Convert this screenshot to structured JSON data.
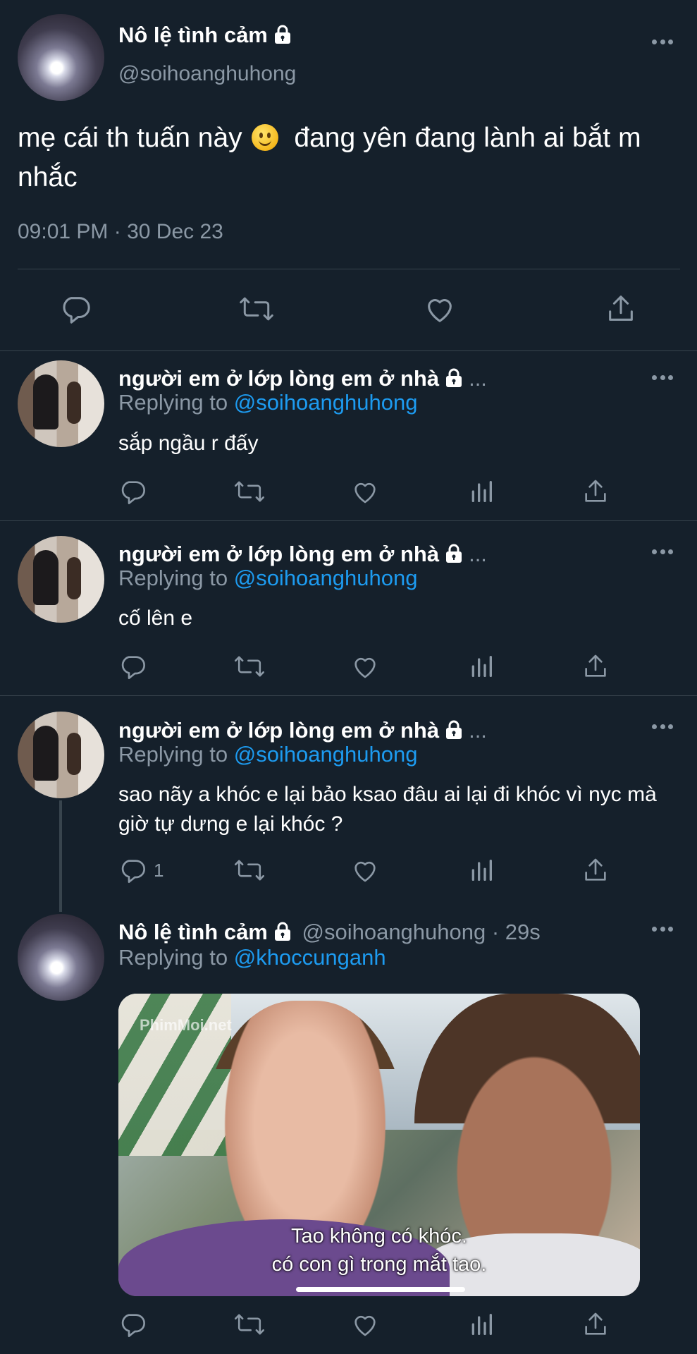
{
  "main_tweet": {
    "name": "Nô lệ tình cảm",
    "handle": "@soihoanghuhong",
    "text_before": "mẹ cái th tuấn này",
    "text_after": "đang yên đang lành ai bắt m nhắc",
    "emoji": "slightly-smiling-face",
    "timestamp": "09:01 PM · 30 Dec 23"
  },
  "replies": [
    {
      "name": "người em ở lớp lòng em ở nhà",
      "ellipsis": "...",
      "replying_label": "Replying to",
      "replying_to": "@soihoanghuhong",
      "text": "sắp ngầu r đấy"
    },
    {
      "name": "người em ở lớp lòng em ở nhà",
      "ellipsis": "...",
      "replying_label": "Replying to",
      "replying_to": "@soihoanghuhong",
      "text": "cố lên e"
    },
    {
      "name": "người em ở lớp lòng em ở nhà",
      "ellipsis": "...",
      "replying_label": "Replying to",
      "replying_to": "@soihoanghuhong",
      "text": "sao nãy a khóc e lại bảo ksao đâu ai lại đi khóc vì nyc mà giờ tự dưng e lại khóc ?",
      "reply_count": "1"
    }
  ],
  "last_reply": {
    "name": "Nô lệ tình cảm",
    "meta": "@soihoanghuhong · 29s",
    "replying_label": "Replying to",
    "replying_to": "@khoccunganh",
    "media_watermark": "PhimMoi.net",
    "subtitle_line1": "Tao không có khóc.",
    "subtitle_line2": "có con gì trong mắt tao."
  },
  "colors": {
    "background": "#15202b",
    "secondary_text": "#8b98a5",
    "mention": "#1d9bf0",
    "divider": "#38444d"
  }
}
